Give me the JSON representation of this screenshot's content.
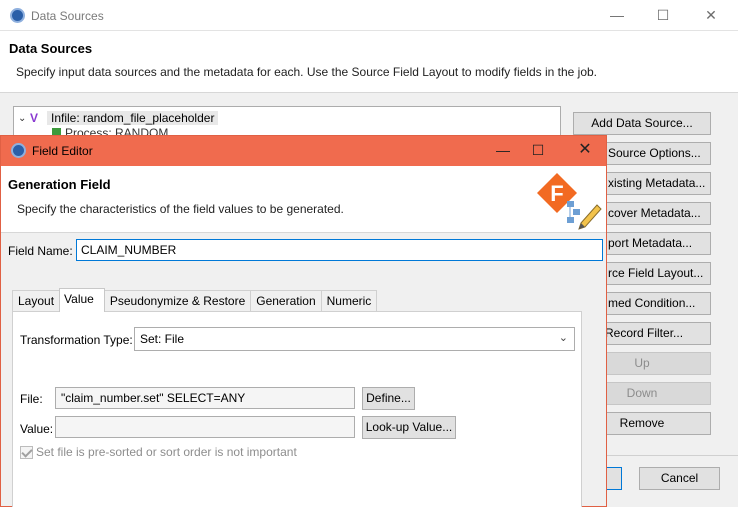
{
  "background_window": {
    "title": "Data Sources",
    "controls": {
      "minimize": "—",
      "maximize": "☐",
      "close": "✕"
    },
    "heading": "Data Sources",
    "description": "Specify input data sources and the metadata for each. Use the Source Field Layout to modify fields in the job.",
    "tree": {
      "item_label": "Infile: random_file_placeholder",
      "sub_item_label": "Process: RANDOM"
    },
    "side_buttons": [
      {
        "label": "Add Data Source...",
        "visible": "Add Data Source...",
        "enabled": true
      },
      {
        "label": "Source Options...",
        "visible": "Source Options...",
        "enabled": true
      },
      {
        "label": "Existing Metadata...",
        "visible": "xisting Metadata...",
        "enabled": true
      },
      {
        "label": "Discover Metadata...",
        "visible": "cover Metadata...",
        "enabled": true
      },
      {
        "label": "Import Metadata...",
        "visible": "port Metadata...",
        "enabled": true
      },
      {
        "label": "Source Field Layout...",
        "visible": "rce Field Layout...",
        "enabled": true
      },
      {
        "label": "Named Condition...",
        "visible": "med Condition...",
        "enabled": true
      },
      {
        "label": "Record Filter...",
        "visible": "Record Filter...",
        "enabled": true
      },
      {
        "label": "Up",
        "visible": "Up",
        "enabled": false
      },
      {
        "label": "Down",
        "visible": "Down",
        "enabled": false
      },
      {
        "label": "Remove",
        "visible": "Remove",
        "enabled": true
      }
    ],
    "cancel_label": "Cancel"
  },
  "field_editor": {
    "title": "Field Editor",
    "controls": {
      "minimize": "—",
      "maximize": "☐",
      "close": "✕"
    },
    "heading": "Generation Field",
    "description": "Specify the characteristics of the field values to be generated.",
    "logo_letter": "F",
    "field_name_label": "Field Name:",
    "field_name_value": "CLAIM_NUMBER",
    "tabs": [
      {
        "label": "Layout",
        "active": false
      },
      {
        "label": "Value",
        "active": true
      },
      {
        "label": "Pseudonymize & Restore",
        "active": false
      },
      {
        "label": "Generation",
        "active": false
      },
      {
        "label": "Numeric",
        "active": false
      }
    ],
    "value_tab": {
      "transformation_type_label": "Transformation Type:",
      "transformation_type_value": "Set: File",
      "file_label": "File:",
      "file_value": "\"claim_number.set\" SELECT=ANY",
      "define_button": "Define...",
      "value_label": "Value:",
      "value_value": "",
      "lookup_button": "Look-up Value...",
      "presorted_checkbox_label": "Set file is pre-sorted or sort order is not important",
      "presorted_checked": true,
      "presorted_enabled": false
    }
  },
  "colors": {
    "field_editor_titlebar": "#f06b4e",
    "focus_border": "#0078d7"
  }
}
